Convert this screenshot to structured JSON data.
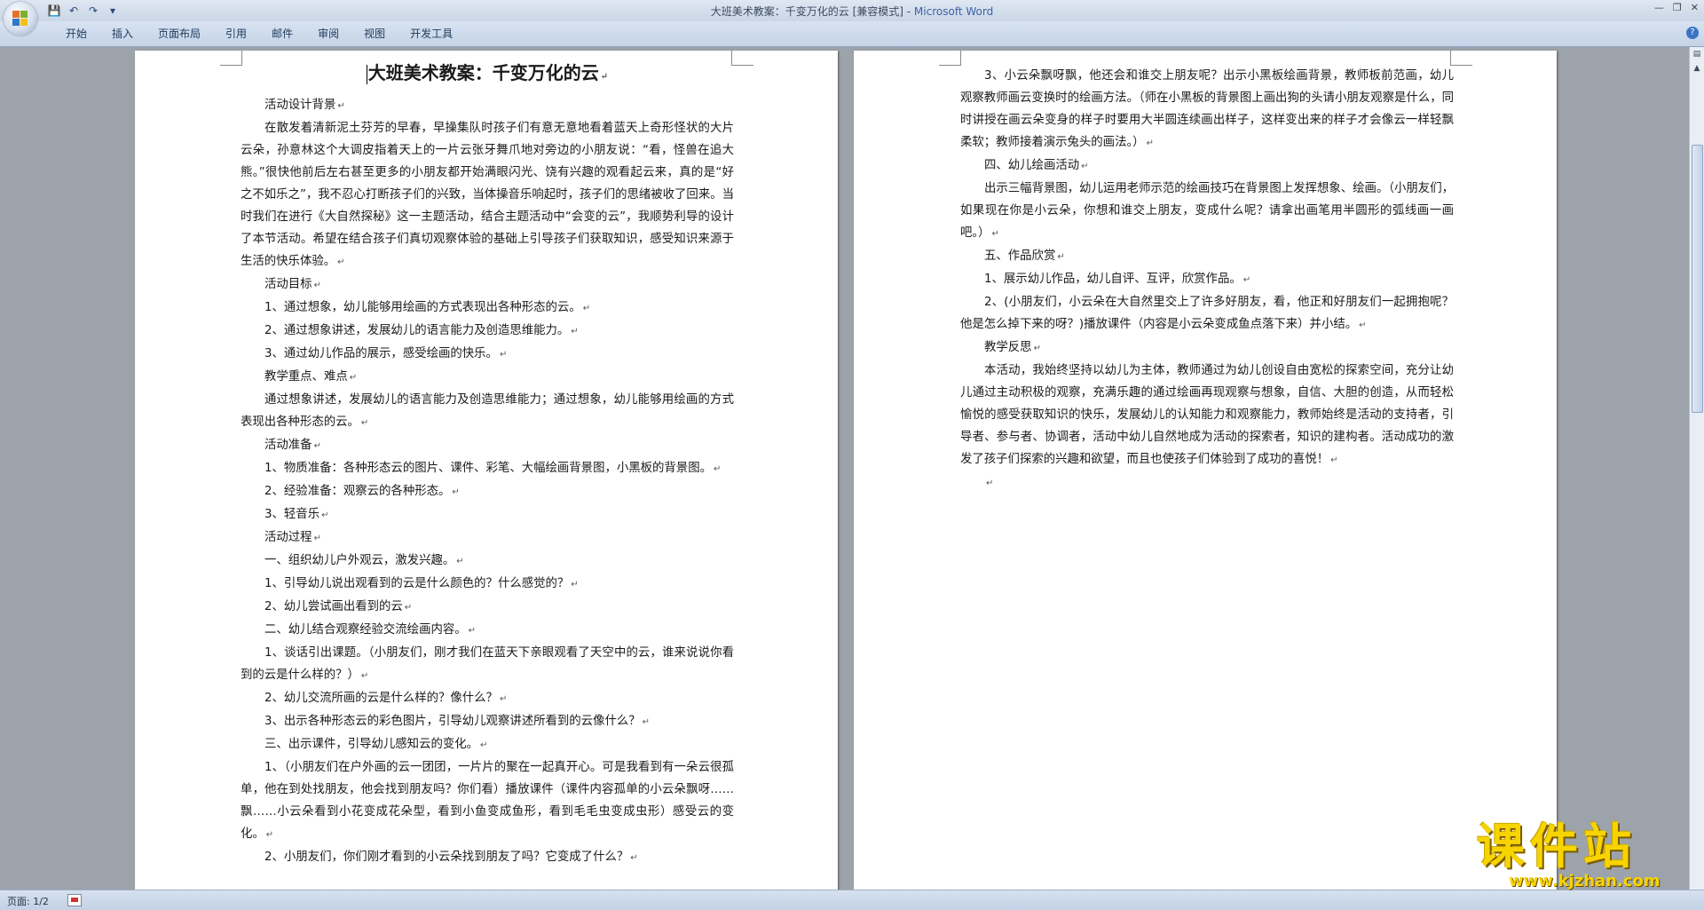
{
  "window": {
    "title": "大班美术教案：千变万化的云 [兼容模式] - ",
    "app": "Microsoft Word",
    "controls": {
      "minimize": "—",
      "restore": "❐",
      "close": "✕"
    }
  },
  "qat": {
    "save_icon": "💾",
    "undo_icon": "↶",
    "redo_icon": "↷",
    "more_icon": "▾"
  },
  "ribbon": {
    "tabs": [
      {
        "label": "开始"
      },
      {
        "label": "插入"
      },
      {
        "label": "页面布局"
      },
      {
        "label": "引用"
      },
      {
        "label": "邮件"
      },
      {
        "label": "审阅"
      },
      {
        "label": "视图"
      },
      {
        "label": "开发工具"
      }
    ],
    "help_icon": "?"
  },
  "page1": {
    "title": "大班美术教案：千变万化的云",
    "paras": [
      "活动设计背景",
      "在散发着清新泥土芬芳的早春，早操集队时孩子们有意无意地看着蓝天上奇形怪状的大片云朵，孙意林这个大调皮指着天上的一片云张牙舞爪地对旁边的小朋友说：“看，怪兽在追大熊。”很快他前后左右甚至更多的小朋友都开始满眼闪光、饶有兴趣的观看起云来，真的是“好之不如乐之”，我不忍心打断孩子们的兴致，当体操音乐响起时，孩子们的思绪被收了回来。当时我们在进行《大自然探秘》这一主题活动，结合主题活动中“会变的云”，我顺势利导的设计了本节活动。希望在结合孩子们真切观察体验的基础上引导孩子们获取知识，感受知识来源于生活的快乐体验。",
      "活动目标",
      "1、通过想象，幼儿能够用绘画的方式表现出各种形态的云。",
      "2、通过想象讲述，发展幼儿的语言能力及创造思维能力。",
      "3、通过幼儿作品的展示，感受绘画的快乐。",
      "教学重点、难点",
      "通过想象讲述，发展幼儿的语言能力及创造思维能力；通过想象，幼儿能够用绘画的方式表现出各种形态的云。",
      "活动准备",
      "1、物质准备：各种形态云的图片、课件、彩笔、大幅绘画背景图，小黑板的背景图。",
      "2、经验准备：观察云的各种形态。",
      "3、轻音乐",
      "活动过程",
      "一、组织幼儿户外观云，激发兴趣。",
      "1、引导幼儿说出观看到的云是什么颜色的？什么感觉的？",
      "2、幼儿尝试画出看到的云",
      "二、幼儿结合观察经验交流绘画内容。",
      "1、谈话引出课题。（小朋友们，刚才我们在蓝天下亲眼观看了天空中的云，谁来说说你看到的云是什么样的？）",
      "2、幼儿交流所画的云是什么样的？像什么？",
      "3、出示各种形态云的彩色图片，引导幼儿观察讲述所看到的云像什么？",
      "三、出示课件，引导幼儿感知云的变化。",
      "1、（小朋友们在户外画的云一团团，一片片的聚在一起真开心。可是我看到有一朵云很孤单，他在到处找朋友，他会找到朋友吗？你们看）播放课件（课件内容孤单的小云朵飘呀……飘……小云朵看到小花变成花朵型，看到小鱼变成鱼形，看到毛毛虫变成虫形）感受云的变化。",
      "2、小朋友们，你们刚才看到的小云朵找到朋友了吗？它变成了什么？"
    ]
  },
  "page2": {
    "paras": [
      "3、小云朵飘呀飘，他还会和谁交上朋友呢？出示小黑板绘画背景，教师板前范画，幼儿观察教师画云变换时的绘画方法。（师在小黑板的背景图上画出狗的头请小朋友观察是什么，同时讲授在画云朵变身的样子时要用大半圆连续画出样子，这样变出来的样子才会像云一样轻飘柔软；教师接着演示兔头的画法。）",
      "四、幼儿绘画活动",
      "出示三幅背景图，幼儿运用老师示范的绘画技巧在背景图上发挥想象、绘画。（小朋友们，如果现在你是小云朵，你想和谁交上朋友，变成什么呢？请拿出画笔用半圆形的弧线画一画吧。）",
      "五、作品欣赏",
      "1、展示幼儿作品，幼儿自评、互评，欣赏作品。",
      "2、(小朋友们，小云朵在大自然里交上了许多好朋友，看，他正和好朋友们一起拥抱呢？他是怎么掉下来的呀？)播放课件（内容是小云朵变成鱼点落下来）并小结。",
      "教学反思",
      "本活动，我始终坚持以幼儿为主体，教师通过为幼儿创设自由宽松的探索空间，充分让幼儿通过主动积极的观察，充满乐趣的通过绘画再现观察与想象，自信、大胆的创造，从而轻松愉悦的感受获取知识的快乐，发展幼儿的认知能力和观察能力，教师始终是活动的支持者，引导者、参与者、协调者，活动中幼儿自然地成为活动的探索者，知识的建构者。活动成功的激发了孩子们探索的兴趣和欲望，而且也使孩子们体验到了成功的喜悦！",
      ""
    ]
  },
  "paragraph_mark": "↵",
  "status": {
    "page": "页面: 1/2"
  },
  "watermark": {
    "text": "课件站",
    "url": "www.kjzhan.com"
  },
  "colors": {
    "brand_yellow": "#f7d400",
    "ribbon_blue": "#c4d3e7",
    "app_title": "#3d62a8"
  }
}
